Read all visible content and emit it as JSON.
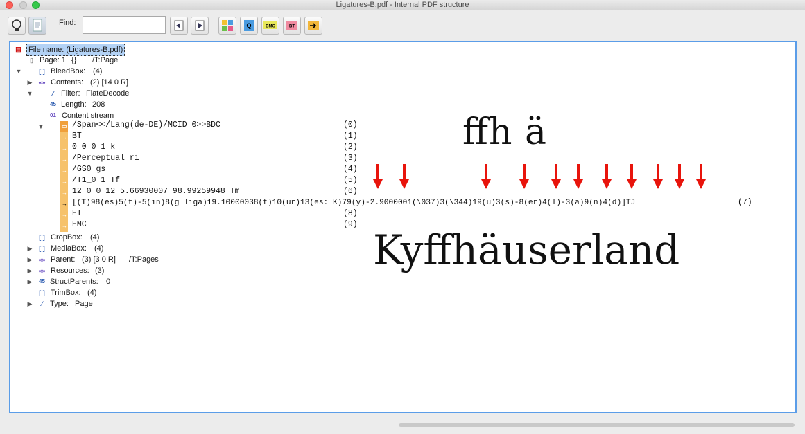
{
  "window": {
    "title": "Ligatures-B.pdf - Internal PDF structure"
  },
  "toolbar": {
    "find_label": "Find:",
    "find_value": "",
    "buttons": [
      {
        "name": "hint-bulb-icon"
      },
      {
        "name": "page-view-icon"
      },
      {
        "name": "find-previous-icon"
      },
      {
        "name": "find-next-icon"
      },
      {
        "name": "puzzle-structure-icon"
      },
      {
        "name": "puzzle-q-icon"
      },
      {
        "name": "puzzle-bmc-icon",
        "text": "BMC"
      },
      {
        "name": "puzzle-bt-icon",
        "text": "BT"
      },
      {
        "name": "puzzle-arrow-icon"
      }
    ]
  },
  "tree": {
    "file": "File name: (Ligatures-B.pdf)",
    "page": {
      "label": "Page: 1",
      "braces": "{}",
      "type": "/T:Page"
    },
    "bleedbox": {
      "label": "BleedBox:",
      "value": "(4)"
    },
    "contents": {
      "label": "Contents:",
      "value": "(2) [14 0 R]"
    },
    "filter": {
      "label": "Filter:",
      "value": "FlateDecode"
    },
    "length": {
      "label": "Length:",
      "value": "208"
    },
    "content_stream": "Content stream",
    "cropbox": {
      "label": "CropBox:",
      "value": "(4)"
    },
    "mediabox": {
      "label": "MediaBox:",
      "value": "(4)"
    },
    "parent": {
      "label": "Parent:",
      "value": "(3) [3 0 R]",
      "type": "/T:Pages"
    },
    "resources": {
      "label": "Resources:",
      "value": "(3)"
    },
    "structparents": {
      "label": "StructParents:",
      "value": "0"
    },
    "trimbox": {
      "label": "TrimBox:",
      "value": "(4)"
    },
    "type": {
      "label": "Type:",
      "value": "Page"
    }
  },
  "stream": [
    {
      "op": "/Span<</Lang(de-DE)/MCID 0>>BDC",
      "idx": "(0)"
    },
    {
      "op": "BT",
      "idx": "(1)"
    },
    {
      "op": "0 0 0 1 k",
      "idx": "(2)"
    },
    {
      "op": "/Perceptual ri",
      "idx": "(3)"
    },
    {
      "op": "/GS0 gs",
      "idx": "(4)"
    },
    {
      "op": "/T1_0 1 Tf",
      "idx": "(5)"
    },
    {
      "op": "12 0 0 12 5.66930007 98.99259948 Tm",
      "idx": "(6)"
    },
    {
      "op": "[(T)98(es)5(t)-5(in)8(g liga)19.10000038(t)10(ur)13(es: K)79(y)-2.9000001(\\037)3(\\344)19(u)3(s)-8(er)4(l)-3(a)9(n)4(d)]TJ",
      "idx": "(7)"
    },
    {
      "op": "ET",
      "idx": "(8)"
    },
    {
      "op": "EMC",
      "idx": "(9)"
    }
  ],
  "overlay": {
    "small_text": "ﬀh ä",
    "big_text": "Kyﬀhäuserland",
    "arrow_color": "#e8140c",
    "arrow_count": 12
  }
}
